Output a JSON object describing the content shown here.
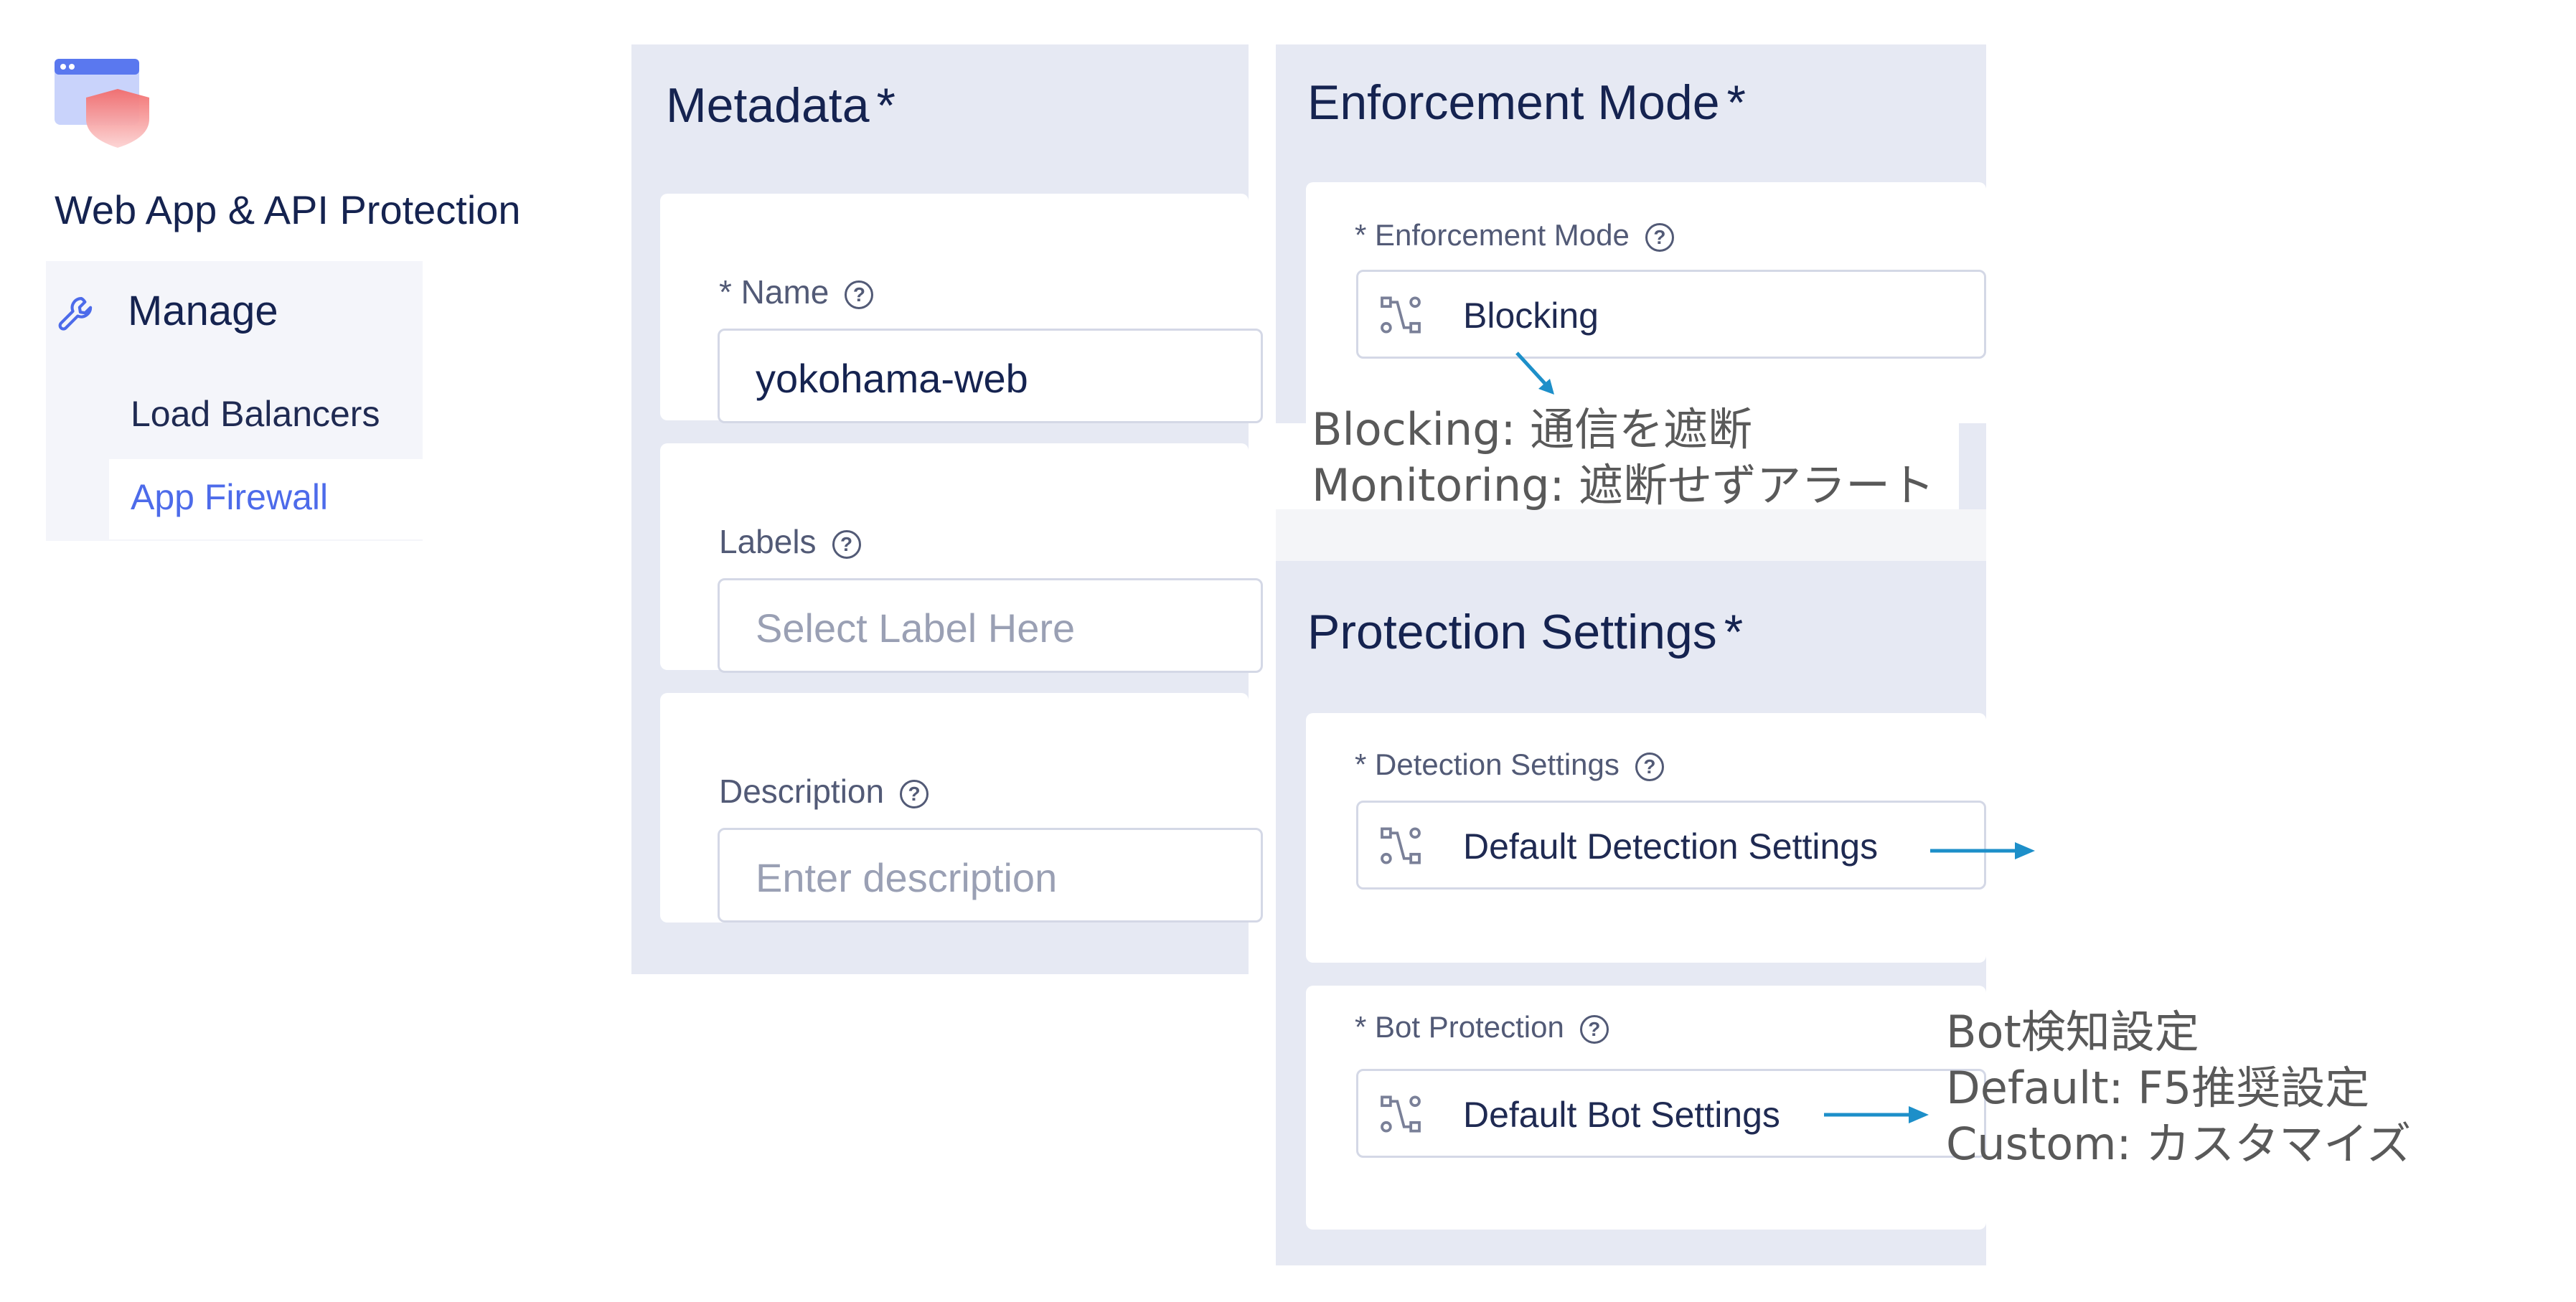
{
  "nav": {
    "app_title": "Web App & API Protection",
    "section": "Manage",
    "items": [
      {
        "label": "Load Balancers",
        "active": false
      },
      {
        "label": "App Firewall",
        "active": true
      }
    ]
  },
  "metadata": {
    "title": "Metadata",
    "required_mark": "*",
    "name": {
      "label": "* Name",
      "value": "yokohama-web"
    },
    "labels": {
      "label": "Labels",
      "placeholder": "Select Label Here"
    },
    "description": {
      "label": "Description",
      "placeholder": "Enter description"
    }
  },
  "enforcement": {
    "title": "Enforcement Mode",
    "required_mark": "*",
    "field_label": "* Enforcement Mode",
    "value": "Blocking"
  },
  "protection": {
    "title": "Protection Settings",
    "required_mark": "*",
    "detection": {
      "label": "* Detection Settings",
      "value": "Default Detection Settings"
    },
    "bot": {
      "label": "* Bot Protection",
      "value": "Default Bot Settings"
    }
  },
  "annotations": {
    "enforcement": [
      "Blocking: 通信を遮断",
      "Monitoring: 遮断せずアラート"
    ],
    "bot": [
      "Bot検知設定",
      "Default: F5推奨設定",
      "Custom: カスタマイズ"
    ]
  },
  "icons": {
    "app_logo": "shield-window-icon",
    "manage": "wrench-icon",
    "select": "route-icon",
    "help": "help-circle-icon"
  },
  "colors": {
    "accent": "#4d6bea",
    "arrow": "#1d8fc9",
    "panel_bg": "#e6e9f3",
    "heading": "#152350"
  }
}
